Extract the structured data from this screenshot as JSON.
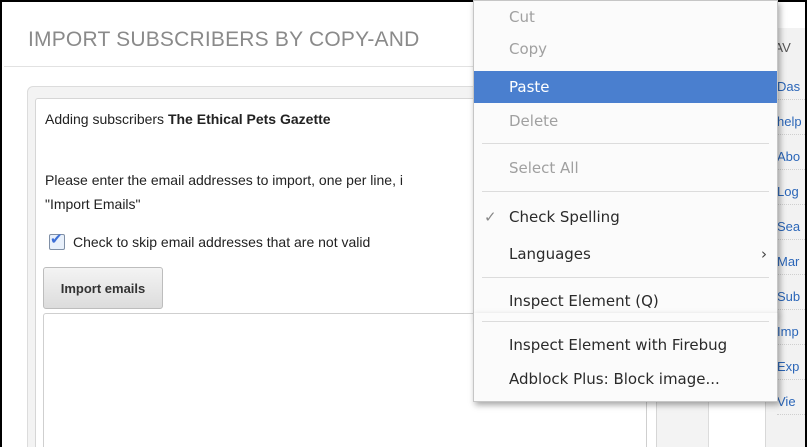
{
  "page": {
    "title": "IMPORT SUBSCRIBERS BY COPY-AND",
    "adding_prefix": "Adding subscribers",
    "list_name": "The Ethical Pets Gazette",
    "instructions_line1": "Please enter the email addresses to import, one per line, i",
    "instructions_line2": "\"Import Emails\"",
    "skip_invalid_label": "Check to skip email addresses that are not valid",
    "skip_invalid_checked": true,
    "import_button": "Import emails",
    "textarea_value": ""
  },
  "sidebar": {
    "heading": "NAV",
    "items": [
      "Das",
      "help",
      "Abo",
      "Log",
      "Sea",
      "Mar",
      "Sub",
      "Imp",
      "Exp",
      "Vie"
    ]
  },
  "context_menu": {
    "items": {
      "cut": {
        "label": "Cut",
        "enabled": false
      },
      "copy": {
        "label": "Copy",
        "enabled": false
      },
      "paste": {
        "label": "Paste",
        "enabled": true,
        "highlighted": true
      },
      "delete": {
        "label": "Delete",
        "enabled": false
      },
      "select_all": {
        "label": "Select All",
        "enabled": false
      },
      "check_spelling": {
        "label": "Check Spelling",
        "checked": true
      },
      "languages": {
        "label": "Languages",
        "submenu": true
      },
      "inspect": {
        "label": "Inspect Element (Q)"
      },
      "inspect_firebug": {
        "label": "Inspect Element with Firebug"
      },
      "adblock": {
        "label": "Adblock Plus: Block image..."
      }
    },
    "highlight_color": "#4a7fcf"
  }
}
